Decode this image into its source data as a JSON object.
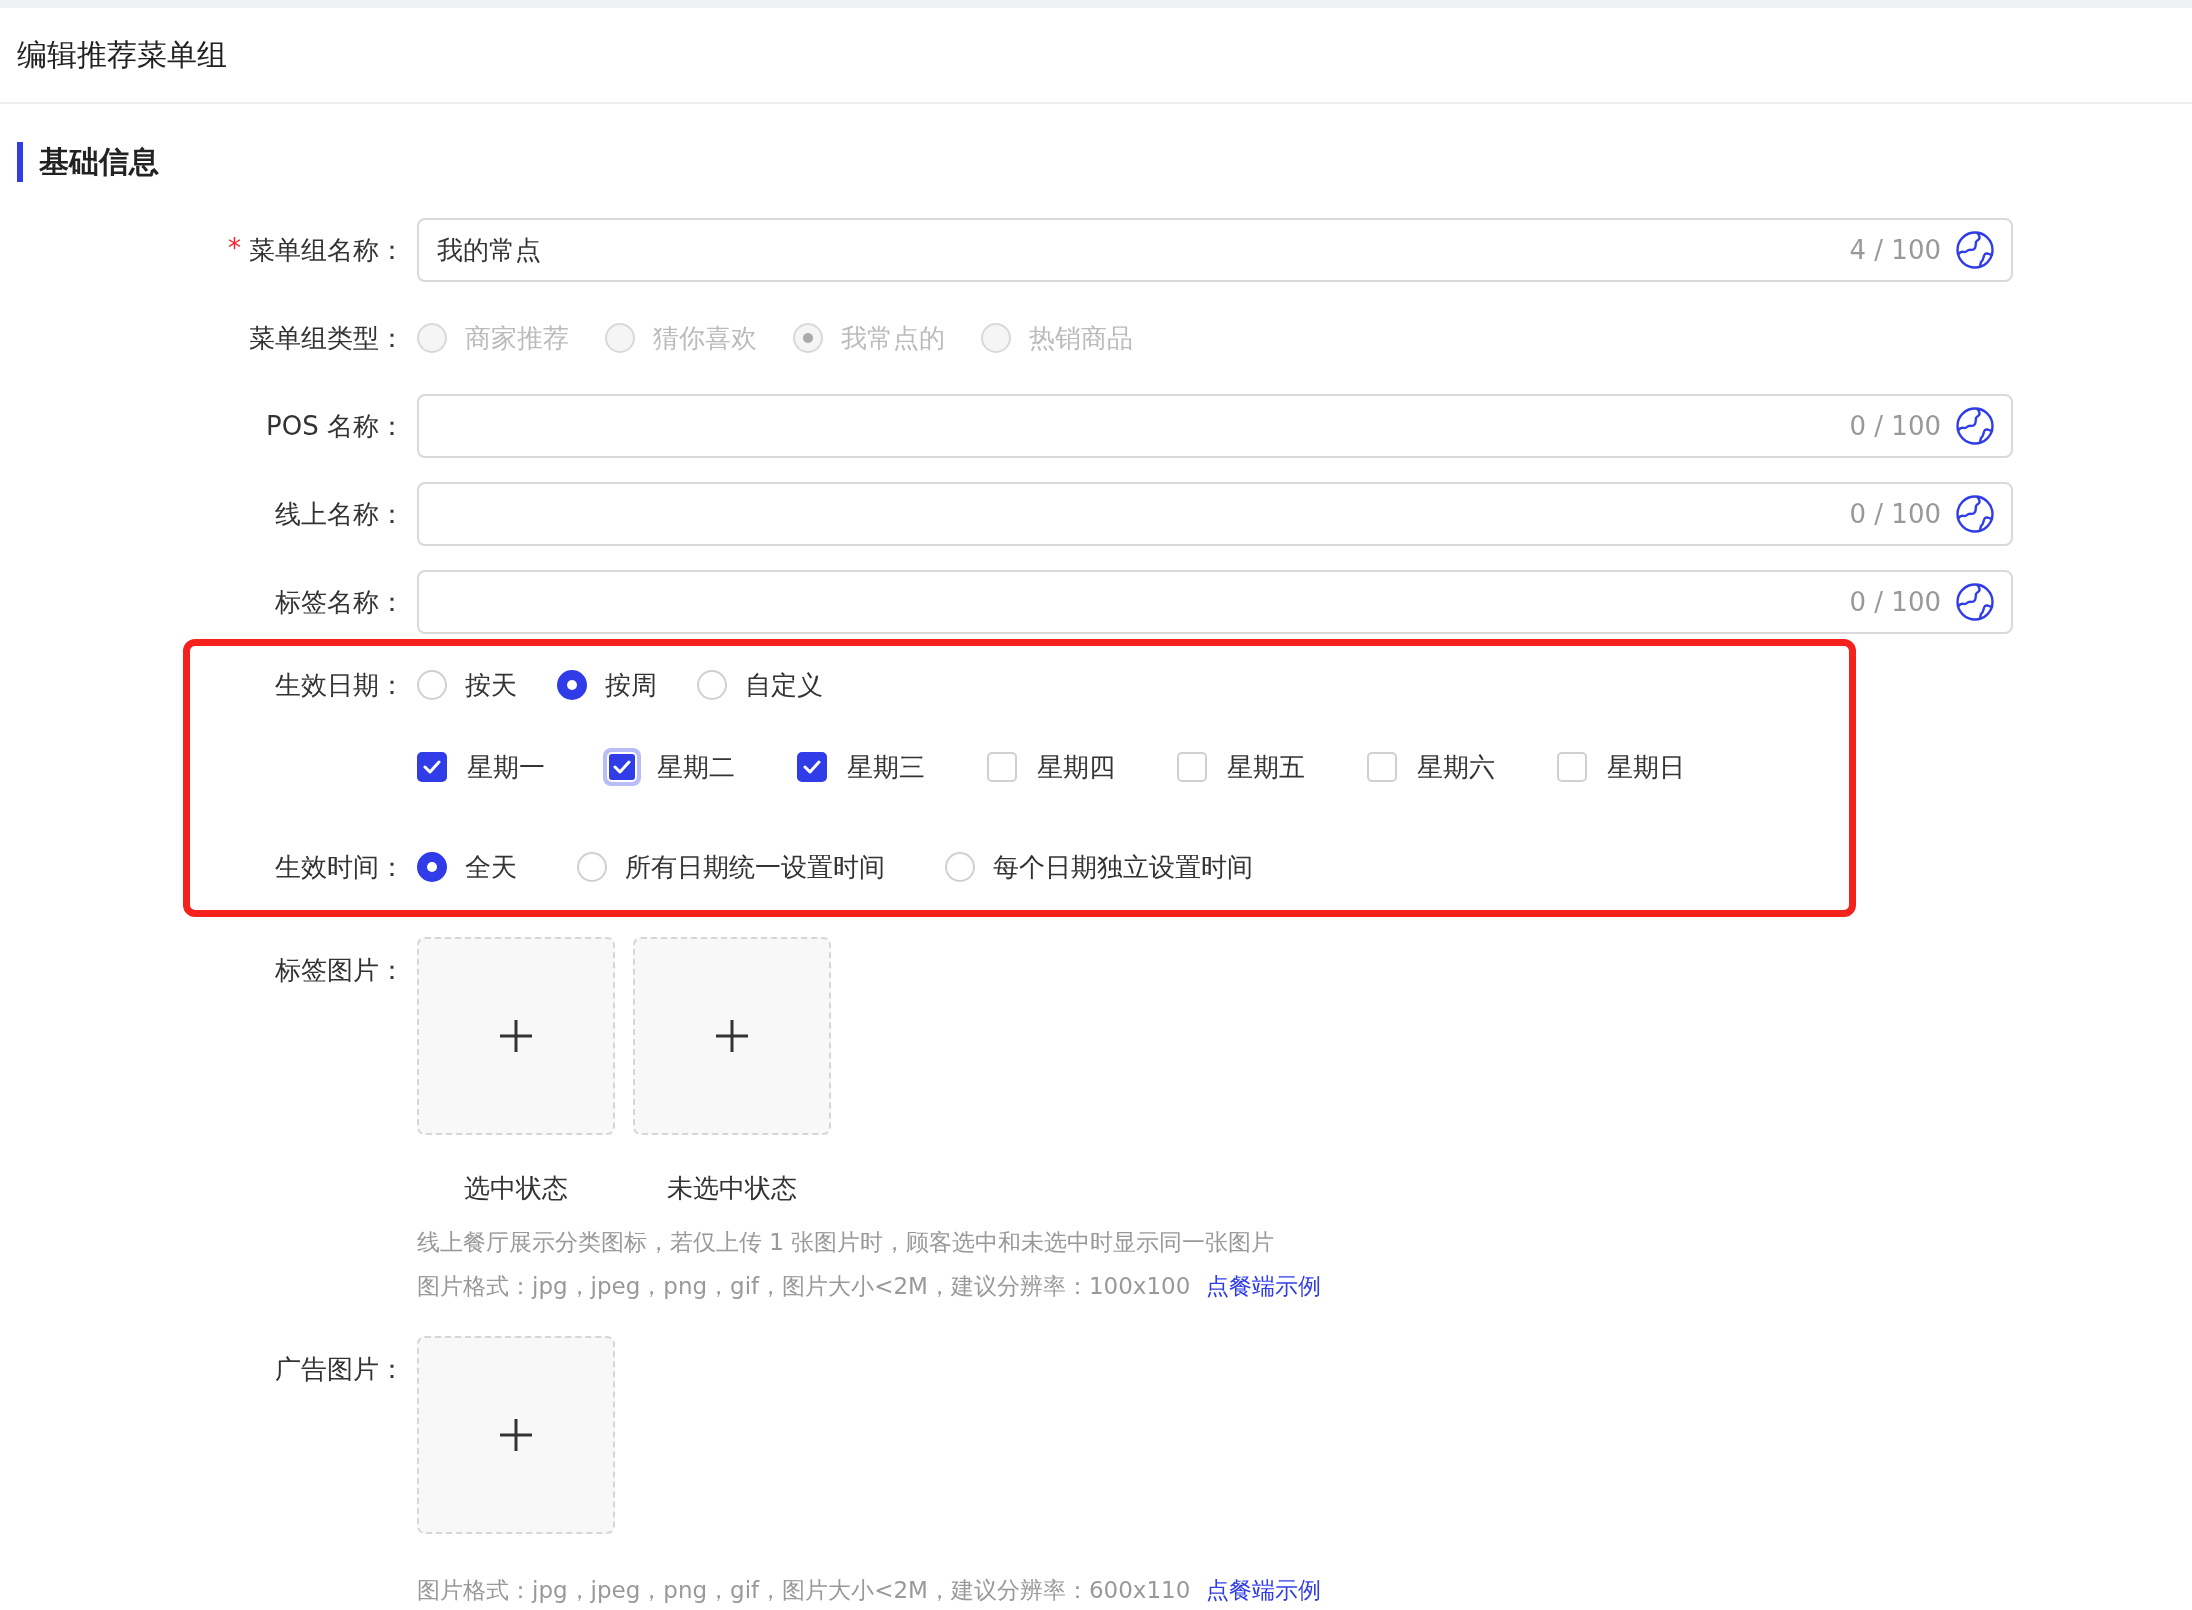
{
  "page": {
    "title": "编辑推荐菜单组"
  },
  "section": {
    "title": "基础信息"
  },
  "fields": [
    {
      "kind": "text",
      "label": "菜单组名称：",
      "required_mark": "*",
      "value": "我的常点",
      "counter": "4 / 100"
    },
    {
      "kind": "radio",
      "label": "菜单组类型：",
      "disabled": true,
      "options": [
        {
          "label": "商家推荐",
          "selected": false
        },
        {
          "label": "猜你喜欢",
          "selected": false
        },
        {
          "label": "我常点的",
          "selected": true
        },
        {
          "label": "热销商品",
          "selected": false
        }
      ]
    },
    {
      "kind": "text",
      "label": "POS 名称：",
      "counter": "0 / 100"
    },
    {
      "kind": "text",
      "label": "线上名称：",
      "counter": "0 / 100"
    },
    {
      "kind": "text",
      "label": "标签名称：",
      "counter": "0 / 100"
    }
  ],
  "schedule": {
    "highlighted": true,
    "date_label": "生效日期：",
    "date_modes": [
      {
        "label": "按天",
        "selected": false
      },
      {
        "label": "按周",
        "selected": true
      },
      {
        "label": "自定义",
        "selected": false
      }
    ],
    "weekdays": [
      {
        "label": "星期一",
        "checked": true,
        "focused": false
      },
      {
        "label": "星期二",
        "checked": true,
        "focused": true
      },
      {
        "label": "星期三",
        "checked": true,
        "focused": false
      },
      {
        "label": "星期四",
        "checked": false,
        "focused": false
      },
      {
        "label": "星期五",
        "checked": false,
        "focused": false
      },
      {
        "label": "星期六",
        "checked": false,
        "focused": false
      },
      {
        "label": "星期日",
        "checked": false,
        "focused": false
      }
    ],
    "time_label": "生效时间：",
    "time_modes": [
      {
        "label": "全天",
        "selected": true
      },
      {
        "label": "所有日期统一设置时间",
        "selected": false
      },
      {
        "label": "每个日期独立设置时间",
        "selected": false
      }
    ]
  },
  "images": [
    {
      "label": "标签图片：",
      "slots": [
        {
          "kind": "upload",
          "caption": "选中状态"
        },
        {
          "kind": "upload",
          "caption": "未选中状态"
        }
      ],
      "notes": [
        {
          "text": "线上餐厅展示分类图标，若仅上传 1 张图片时，顾客选中和未选中时显示同一张图片"
        },
        {
          "text": "图片格式：jpg，jpeg，png，gif，图片大小<2M，建议分辨率：100x100",
          "link": "点餐端示例"
        }
      ]
    },
    {
      "label": "广告图片：",
      "slots": [
        {
          "kind": "upload"
        }
      ],
      "notes": [
        {
          "text": "图片格式：jpg，jpeg，png，gif，图片大小<2M，建议分辨率：600x110",
          "link": "点餐端示例"
        }
      ]
    }
  ]
}
